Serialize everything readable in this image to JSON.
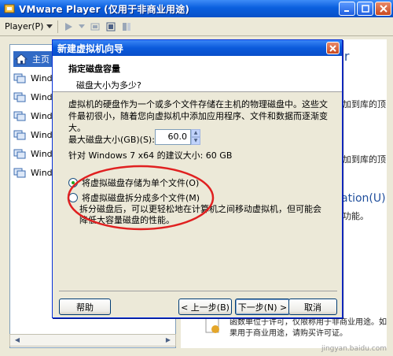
{
  "window": {
    "title": "VMware Player (仅用于非商业用途)",
    "controls": [
      "minimize",
      "maximize",
      "close"
    ]
  },
  "toolbar": {
    "player_menu": "Player(P)",
    "icons": [
      "play-icon",
      "dropdown-icon",
      "suspend-icon",
      "fullscreen-icon",
      "unity-icon"
    ]
  },
  "library": {
    "home_label": "主页",
    "items": [
      "Windo",
      "Windo",
      "Windo",
      "Windo",
      "Windo",
      "Windo"
    ]
  },
  "background": {
    "heading_fragment": "er",
    "line1": "加到库的顶",
    "line2": "加到库的顶",
    "link_fragment": "ation(U)",
    "line3": "功能。",
    "footer1": "函数单位于许可，仅限称用于非商业用途。如",
    "footer2": "果用于商业用途，请购买许可证。"
  },
  "dialog": {
    "title": "新建虚拟机向导",
    "heading": "指定磁盘容量",
    "subheading": "磁盘大小为多少?",
    "description": "虚拟机的硬盘作为一个或多个文件存储在主机的物理磁盘中。这些文件最初很小，随着您向虚拟机中添加应用程序、文件和数据而逐渐变大。",
    "max_size_label": "最大磁盘大小(GB)(S):",
    "max_size_value": "60.0",
    "recommended": "针对 Windows 7 x64 的建议大小: 60 GB",
    "option_single": "将虚拟磁盘存储为单个文件(O)",
    "option_split": "将虚拟磁盘拆分成多个文件(M)",
    "split_note": "拆分磁盘后，可以更轻松地在计算机之间移动虚拟机，但可能会降低大容量磁盘的性能。",
    "selected_option": "single",
    "buttons": {
      "help": "帮助",
      "back": "< 上一步(B)",
      "next": "下一步(N) >",
      "cancel": "取消"
    }
  },
  "annotation_color": "#E02020",
  "watermark": "jingyan.baidu.com"
}
